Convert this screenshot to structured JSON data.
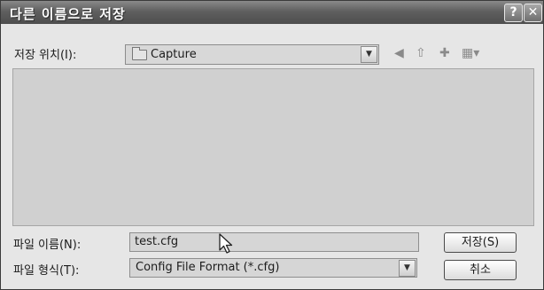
{
  "window": {
    "title": "다른 이름으로 저장",
    "help_label": "?",
    "close_label": "✕"
  },
  "location": {
    "label": "저장 위치(I):",
    "value": "Capture",
    "icon": "folder-icon"
  },
  "toolbar": {
    "icons": [
      "back-icon",
      "up-folder-icon",
      "new-folder-icon",
      "views-menu-icon"
    ]
  },
  "file_name": {
    "label": "파일 이름(N):",
    "value": "test.cfg"
  },
  "file_type": {
    "label": "파일 형식(T):",
    "value": "Config File Format (*.cfg)"
  },
  "buttons": {
    "save": "저장(S)",
    "cancel": "취소"
  }
}
